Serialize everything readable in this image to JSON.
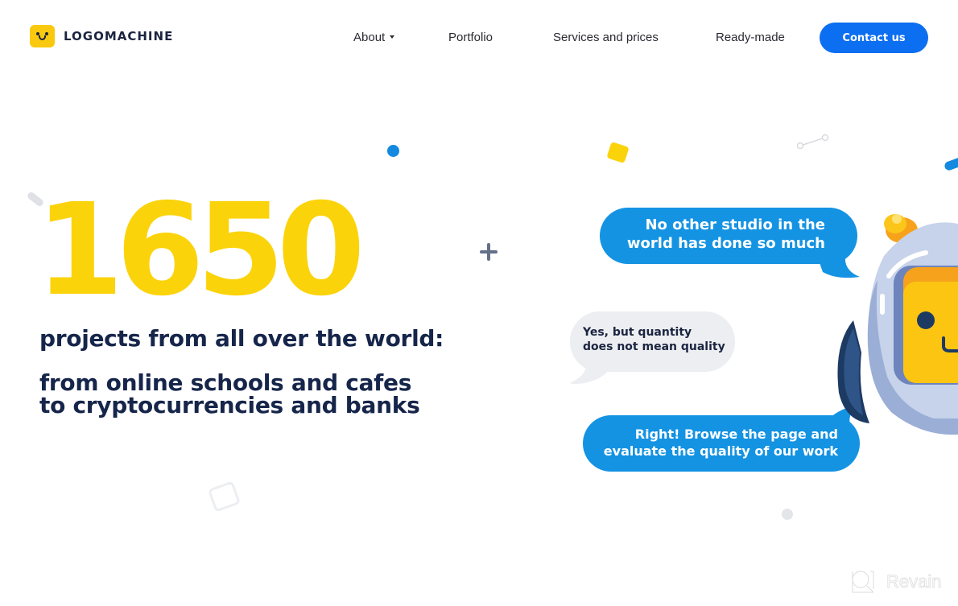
{
  "header": {
    "logo_text": "LOGOMACHINE",
    "nav": [
      {
        "label": "About",
        "has_dropdown": true
      },
      {
        "label": "Portfolio"
      },
      {
        "label": "Services and prices"
      },
      {
        "label": "Ready-made"
      }
    ],
    "contact_button": "Contact us"
  },
  "hero": {
    "count": "1650",
    "subtitle": "projects from all over the world:",
    "description_line1": "from online schools and cafes",
    "description_line2": "to cryptocurrencies and banks"
  },
  "chat": {
    "bubble1_line1": "No other studio in the",
    "bubble1_line2": "world has done so much",
    "bubble2_line1": "Yes, but quantity",
    "bubble2_line2": "does not mean quality",
    "bubble3_line1": "Right! Browse the page and",
    "bubble3_line2": "evaluate the quality of our work"
  },
  "watermark": {
    "text": "Revain",
    "icon": "revain-logo-icon"
  },
  "colors": {
    "brand_yellow": "#fbd30a",
    "primary_blue": "#0c6ef0",
    "bubble_blue": "#1493e3",
    "text_navy": "#16254a",
    "bubble_grey": "#eceef1"
  }
}
